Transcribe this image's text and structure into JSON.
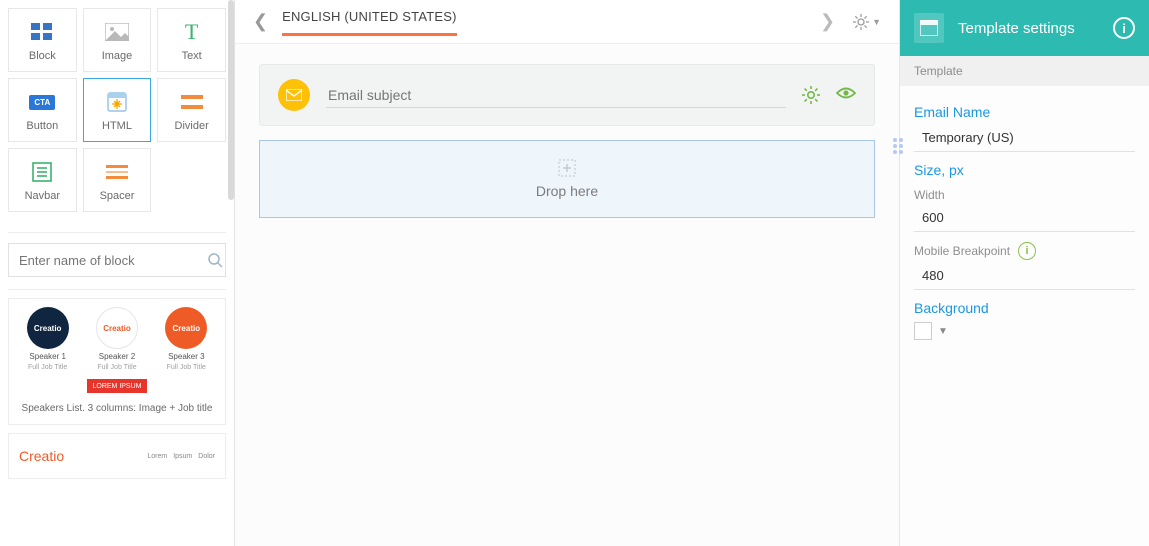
{
  "tools": {
    "block": "Block",
    "image": "Image",
    "text": "Text",
    "button": "Button",
    "html": "HTML",
    "divider": "Divider",
    "navbar": "Navbar",
    "spacer": "Spacer"
  },
  "search": {
    "placeholder": "Enter name of block"
  },
  "template_preview": {
    "brand": "Creatio",
    "speaker1": "Speaker 1",
    "speaker2": "Speaker 2",
    "speaker3": "Speaker 3",
    "jobtitle": "Full Job Title",
    "lorem": "LOREM IPSUM",
    "caption_speakers": "Speakers List. 3 columns: Image + Job title",
    "nav1": "Lorem",
    "nav2": "Ipsum",
    "nav3": "Dolor"
  },
  "lang": {
    "label": "ENGLISH (UNITED STATES)"
  },
  "subject": {
    "placeholder": "Email subject"
  },
  "dropzone": {
    "text": "Drop here"
  },
  "right": {
    "title": "Template settings",
    "section": "Template",
    "emailname_label": "Email Name",
    "emailname_value": "Temporary (US)",
    "size_label": "Size, px",
    "width_label": "Width",
    "width_value": "600",
    "breakpoint_label": "Mobile Breakpoint",
    "breakpoint_value": "480",
    "background_label": "Background"
  }
}
